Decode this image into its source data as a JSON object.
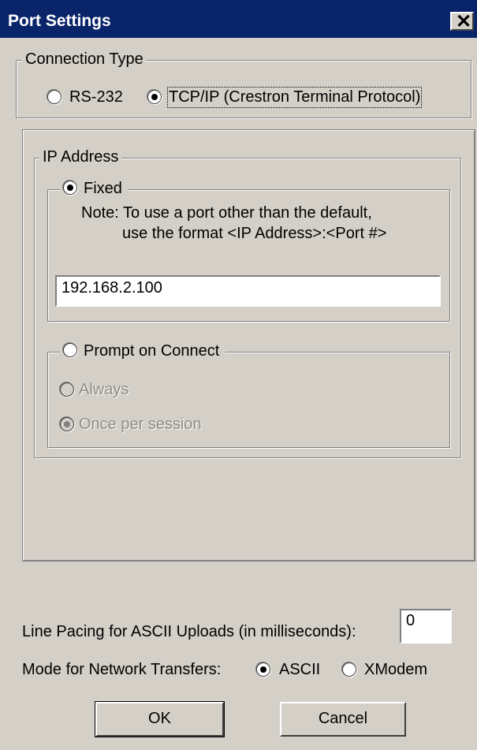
{
  "window": {
    "title": "Port Settings",
    "close_glyph": "✕"
  },
  "connection_type": {
    "legend": "Connection Type",
    "options": [
      {
        "label": "RS-232",
        "checked": false
      },
      {
        "label": "TCP/IP (Crestron Terminal Protocol)",
        "checked": true
      }
    ]
  },
  "ip_address": {
    "legend": "IP Address",
    "fixed": {
      "label": "Fixed",
      "checked": true,
      "note_line1": "Note: To use a port other than the default,",
      "note_line2": "use the format <IP Address>:<Port #>",
      "value": "192.168.2.100"
    },
    "prompt": {
      "label": "Prompt on Connect",
      "checked": false,
      "always_label": "Always",
      "once_label": "Once per session",
      "once_checked": true
    }
  },
  "line_pacing": {
    "label": "Line Pacing for ASCII Uploads (in milliseconds):",
    "value": "0"
  },
  "network_mode": {
    "label": "Mode for Network Transfers:",
    "options": [
      {
        "label": "ASCII",
        "checked": true
      },
      {
        "label": "XModem",
        "checked": false
      }
    ]
  },
  "buttons": {
    "ok": "OK",
    "cancel": "Cancel"
  }
}
